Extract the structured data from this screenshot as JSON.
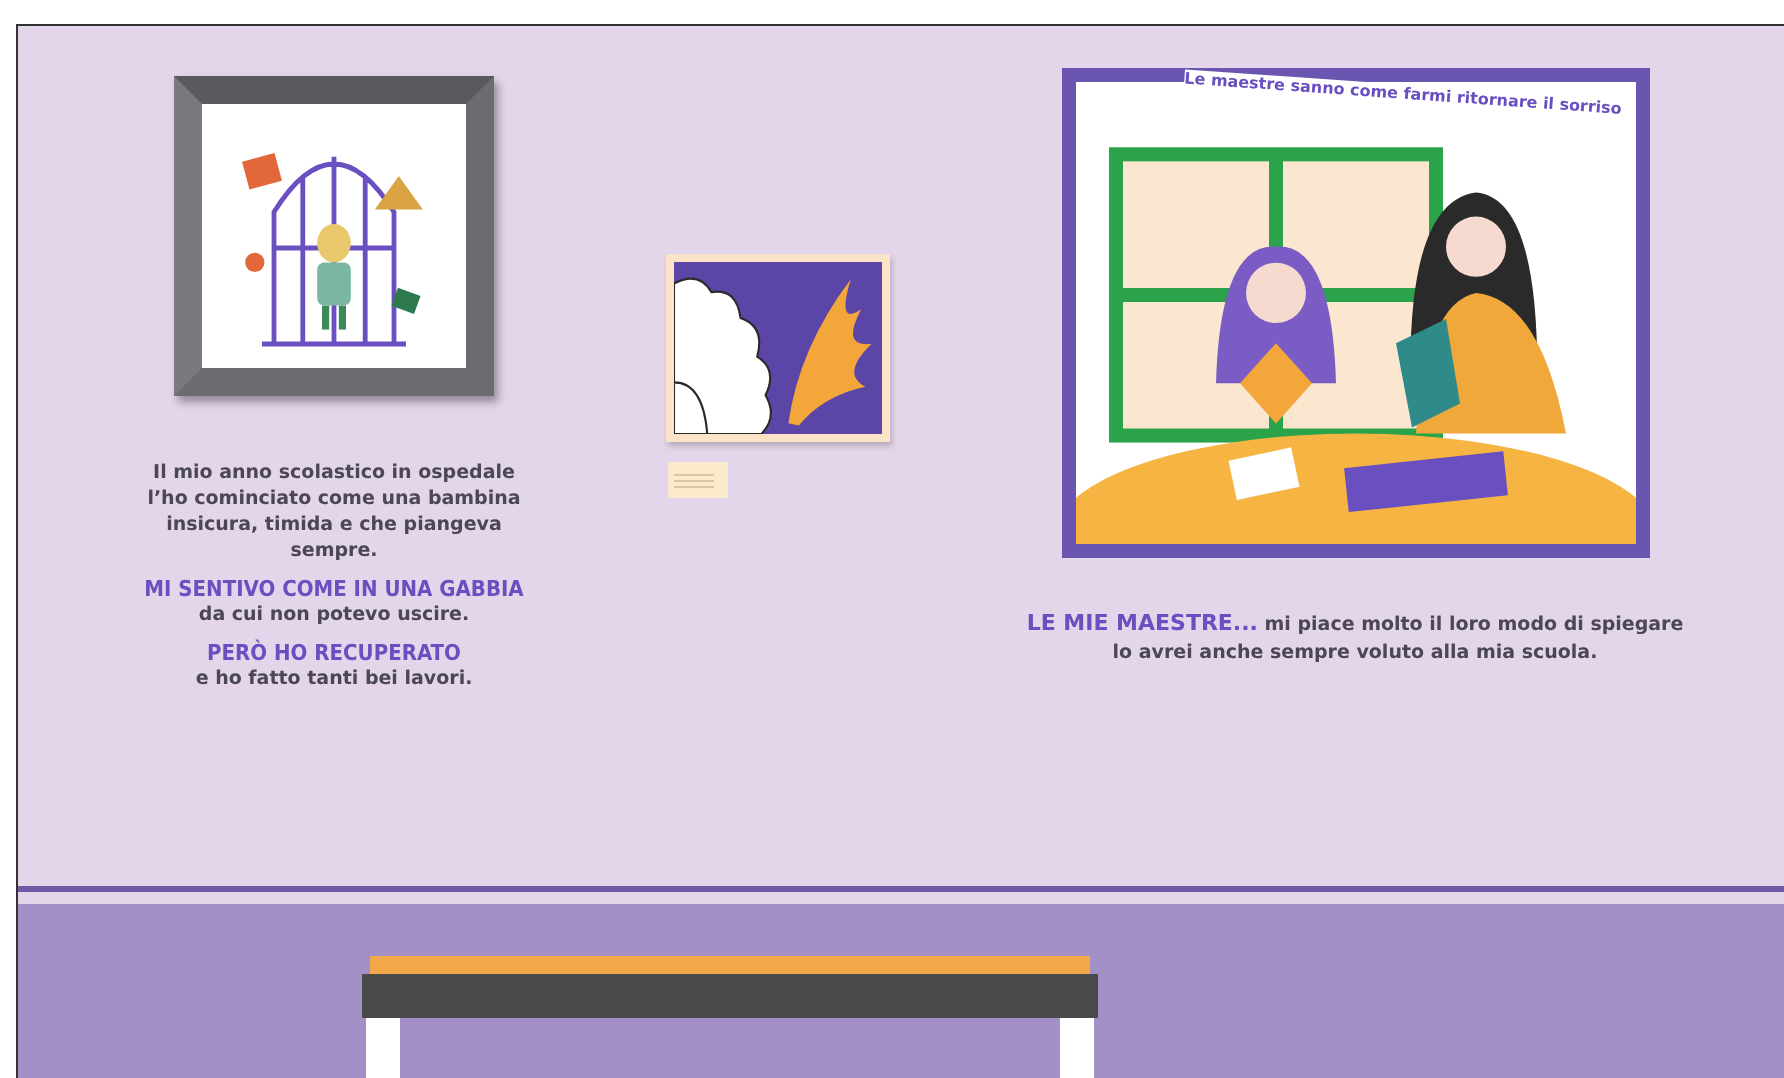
{
  "left_exhibit": {
    "caption": [
      {
        "kind": "body",
        "text": "Il mio anno scolastico in ospedale\nl’ho cominciato come una bambina\ninsicura, timida e che piangeva\nsempre."
      },
      {
        "kind": "heading",
        "text": "MI SENTIVO COME IN UNA GABBIA"
      },
      {
        "kind": "body",
        "text": "da cui non potevo uscire."
      },
      {
        "kind": "heading",
        "text": "PERÒ HO RECUPERATO"
      },
      {
        "kind": "body",
        "text": "e ho fatto tanti bei lavori."
      }
    ]
  },
  "right_exhibit": {
    "artwork_text": "Le maestre sanno come farmi ritornare il sorriso",
    "caption": [
      {
        "kind": "body",
        "text": "**LE MIE MAESTRE...** mi piace molto il loro modo di spiegare\nlo avrei anche sempre voluto alla mia scuola."
      }
    ]
  }
}
